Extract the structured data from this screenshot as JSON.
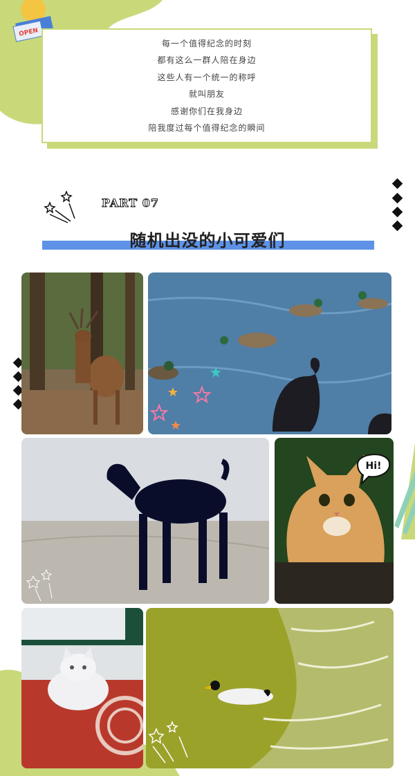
{
  "sticker": {
    "text": "OPEN"
  },
  "poem": {
    "lines": [
      "每一个值得纪念的时刻",
      "都有这么一群人陪在身边",
      "这些人有一个统一的称呼",
      "就叫朋友",
      "感谢你们在我身边",
      "陪我度过每个值得纪念的瞬间"
    ]
  },
  "section": {
    "part": "PART 07",
    "title": "随机出没的小可爱们"
  },
  "photos": {
    "deer": "deer-photo",
    "ducks": "ducks-and-black-swan-photo",
    "goat": "black-goat-photo",
    "cat": "orange-cat-photo",
    "white_cat": "white-cat-photo",
    "pond": "duck-in-pond-photo"
  },
  "speech_bubble": {
    "text": "Hi!"
  },
  "colors": {
    "accent_green": "#c9d97a",
    "accent_blue": "#5d92e6"
  }
}
